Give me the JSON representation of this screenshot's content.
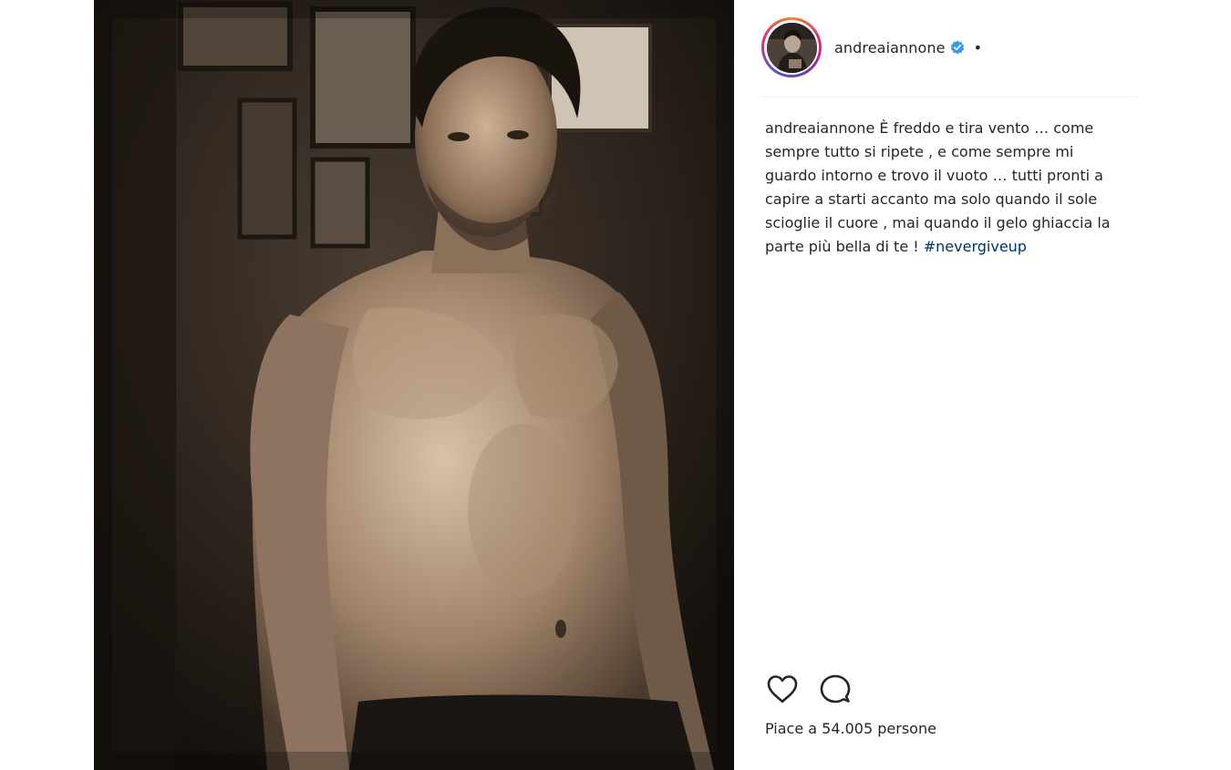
{
  "post": {
    "photo_icon": "portrait-photo",
    "photo_tone": "#2a211a"
  },
  "header": {
    "username": "andreaiannone",
    "verified_icon": "verified-badge-icon",
    "verified_color": "#3897f0",
    "more_dot": "•"
  },
  "caption": {
    "username": "andreaiannone",
    "text": " È freddo e tira vento … come sempre tutto si ripete , e come sempre mi guardo intorno e trovo il vuoto … tutti pronti a capire a starti accanto ma solo quando il sole scioglie il cuore , mai quando il gelo ghiaccia la parte più bella di te ! ",
    "hashtag": "#nevergiveup",
    "hashtag_color": "#003569"
  },
  "actions": {
    "like_icon": "heart-icon",
    "comment_icon": "comment-icon"
  },
  "likes": {
    "text": "Piace a 54.005 persone"
  }
}
